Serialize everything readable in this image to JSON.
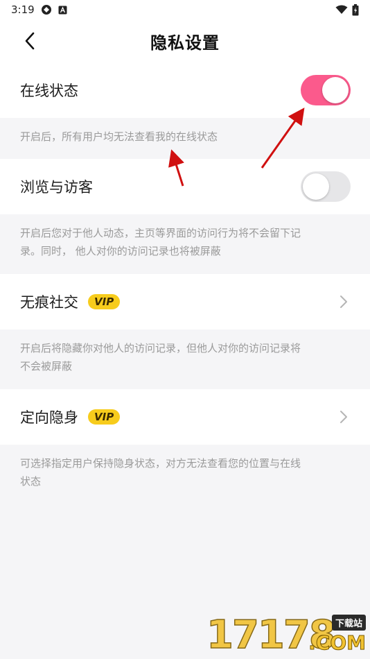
{
  "statusbar": {
    "time": "3:19"
  },
  "navbar": {
    "title": "隐私设置"
  },
  "settings": [
    {
      "label": "在线状态",
      "toggle": "on",
      "desc_lines": [
        "开启后，所有用户均无法查看我的在线状态"
      ]
    },
    {
      "label": "浏览与访客",
      "toggle": "off",
      "desc_lines": [
        "开启后您对于他人动态，主页等界面的访问行为将不会留下记",
        "录。同时， 他人对你的访问记录也将被屏蔽"
      ]
    },
    {
      "label": "无痕社交",
      "badge": "VIP",
      "desc_lines": [
        "开启后将隐藏你对他人的访问记录，但他人对你的访问记录将",
        "不会被屏蔽"
      ]
    },
    {
      "label": "定向隐身",
      "badge": "VIP",
      "desc_lines": [
        "可选择指定用户保持隐身状态，对方无法查看您的位置与在线",
        "状态"
      ]
    }
  ],
  "watermark": {
    "number": "17178",
    "site": "下载站",
    "domain": ".COM"
  },
  "colors": {
    "accent": "#fb5a8c",
    "vip": "#f7cc1c",
    "annotation": "#d01010"
  }
}
